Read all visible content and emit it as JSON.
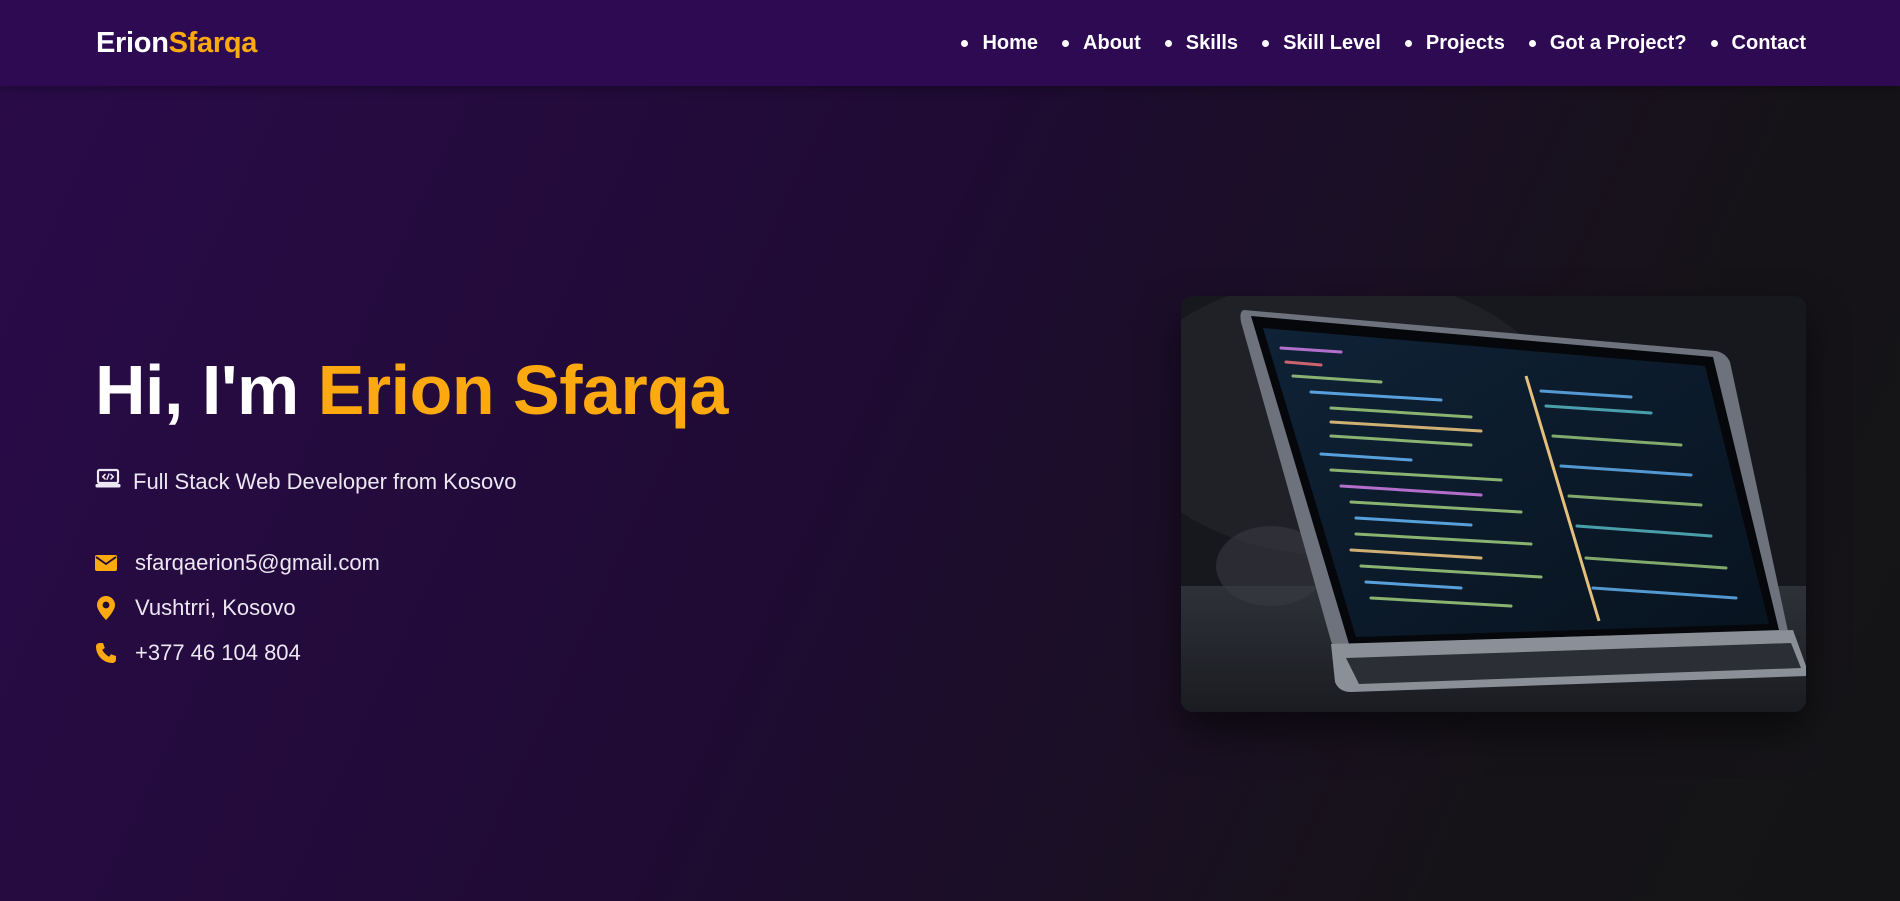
{
  "header": {
    "logo_first": "Erion",
    "logo_last": "Sfarqa",
    "nav": [
      {
        "label": "Home"
      },
      {
        "label": "About"
      },
      {
        "label": "Skills"
      },
      {
        "label": "Skill Level"
      },
      {
        "label": "Projects"
      },
      {
        "label": "Got a Project?"
      },
      {
        "label": "Contact"
      }
    ]
  },
  "hero": {
    "greeting": "Hi, I'm",
    "name": "Erion Sfarqa",
    "role": "Full Stack Web Developer from Kosovo",
    "role_icon": "laptop-code-icon",
    "contacts": [
      {
        "icon": "envelope-icon",
        "text": "sfarqaerion5@gmail.com"
      },
      {
        "icon": "map-pin-icon",
        "text": "Vushtrri, Kosovo"
      },
      {
        "icon": "phone-icon",
        "text": "+377 46 104 804"
      }
    ],
    "image": "laptop-with-code-editor-photo"
  },
  "colors": {
    "accent": "#fba90e",
    "navbar": "#2d0a52",
    "background": "#1f0b33",
    "text": "#ffffff"
  }
}
